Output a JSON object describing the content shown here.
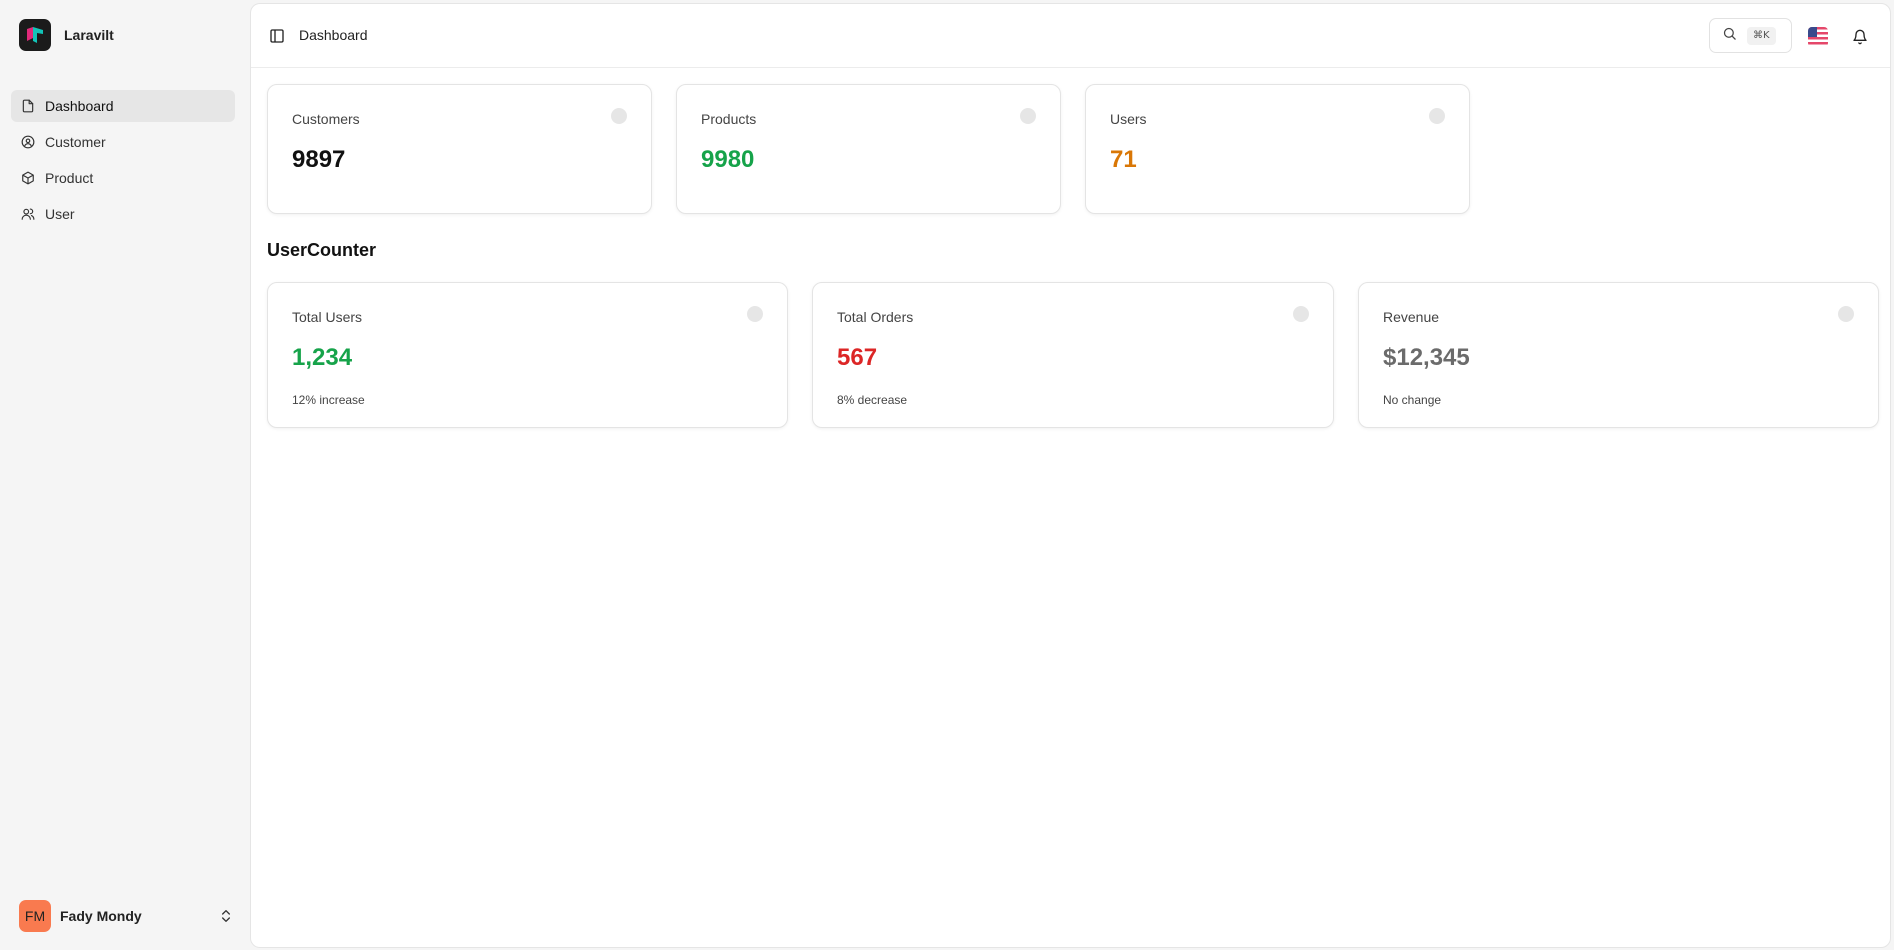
{
  "app": {
    "name": "Laravilt"
  },
  "sidebar": {
    "items": [
      {
        "label": "Dashboard",
        "icon": "file-icon",
        "active": true
      },
      {
        "label": "Customer",
        "icon": "user-circle-icon"
      },
      {
        "label": "Product",
        "icon": "package-icon"
      },
      {
        "label": "User",
        "icon": "users-icon"
      }
    ],
    "user": {
      "initials": "FM",
      "name": "Fady Mondy"
    }
  },
  "topbar": {
    "breadcrumb": "Dashboard",
    "search_shortcut": "⌘K"
  },
  "stats": [
    {
      "label": "Customers",
      "value": "9897",
      "color": "#111111"
    },
    {
      "label": "Products",
      "value": "9980",
      "color": "#16a34a"
    },
    {
      "label": "Users",
      "value": "71",
      "color": "#d97706"
    }
  ],
  "section": {
    "title": "UserCounter"
  },
  "counters": [
    {
      "label": "Total Users",
      "value": "1,234",
      "description": "12% increase",
      "color": "#16a34a"
    },
    {
      "label": "Total Orders",
      "value": "567",
      "description": "8% decrease",
      "color": "#dc2626"
    },
    {
      "label": "Revenue",
      "value": "$12,345",
      "description": "No change",
      "color": "#6b6b6b"
    }
  ]
}
